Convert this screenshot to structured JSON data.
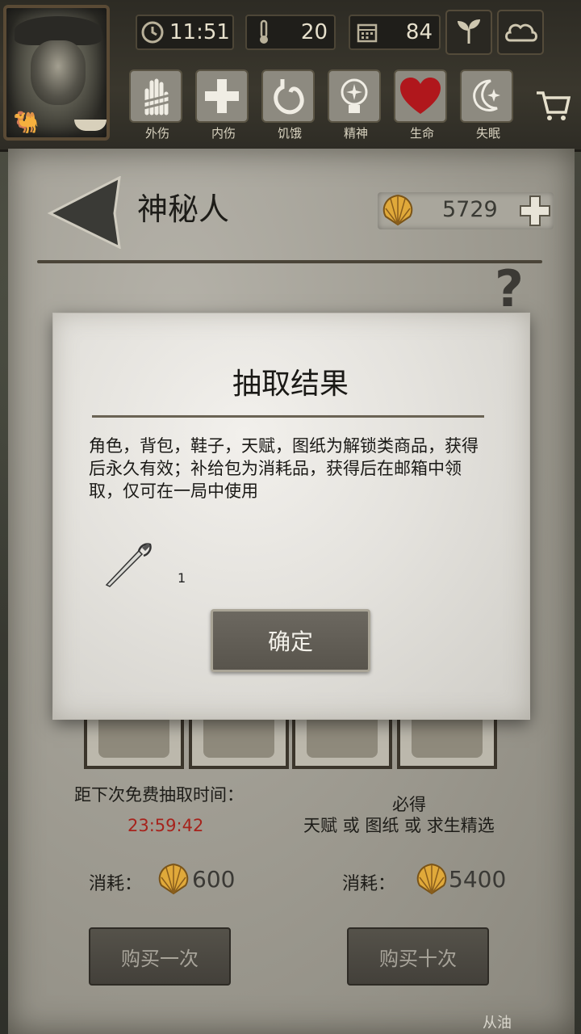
{
  "hud": {
    "time": "11:51",
    "temperature": "20",
    "days": "84",
    "icons": [
      "clock-icon",
      "thermometer-icon",
      "calendar-icon",
      "sprout-icon",
      "cloud-icon"
    ]
  },
  "status": [
    {
      "label": "外伤",
      "icon": "hand-bandage-icon",
      "color": "#8d8a80"
    },
    {
      "label": "内伤",
      "icon": "cross-icon",
      "color": "#8d8a80"
    },
    {
      "label": "饥饿",
      "icon": "stomach-icon",
      "color": "#8d8a80"
    },
    {
      "label": "精神",
      "icon": "brain-icon",
      "color": "#8d8a80"
    },
    {
      "label": "生命",
      "icon": "heart-icon",
      "color": "#b0171c"
    },
    {
      "label": "失眠",
      "icon": "moon-star-icon",
      "color": "#8d8a80"
    }
  ],
  "shop": {
    "title": "神秘人",
    "currency": "5729",
    "free_draw_label": "距下次免费抽取时间：",
    "timer": "23:59:42",
    "guarantee_line1": "必得",
    "guarantee_line2": "天赋 或 图纸 或 求生精选",
    "cost_label": "消耗：",
    "cost_single": "600",
    "cost_ten": "5400",
    "buy_once": "购买一次",
    "buy_ten": "购买十次",
    "edge_text": "从油"
  },
  "dialog": {
    "title": "抽取结果",
    "body": "角色，背包，鞋子，天赋，图纸为解锁类商品，获得后永久有效；补给包为消耗品，获得后在邮箱中领取，仅可在一局中使用",
    "reward_count": "1",
    "confirm": "确定"
  },
  "colors": {
    "timer_red": "#a6231c",
    "heart_red": "#b0171c"
  }
}
